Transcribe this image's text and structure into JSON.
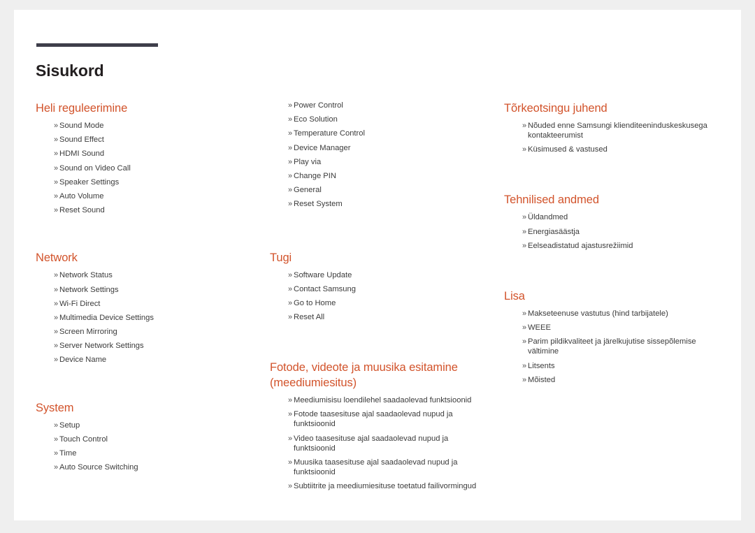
{
  "document": {
    "title": "Sisukord",
    "marker": "»",
    "accent_color": "#d2532b",
    "rule_color": "#3e3e4a",
    "title_color": "#231f20",
    "text_color": "#3b3b3b",
    "page_background": "#ffffff",
    "canvas_background": "#efefef"
  },
  "columns": [
    {
      "name": "column-1",
      "sections": [
        {
          "heading": "Heli reguleerimine",
          "entries": [
            "Sound Mode",
            "Sound Effect",
            "HDMI Sound",
            "Sound on Video Call",
            "Speaker Settings",
            "Auto Volume",
            "Reset Sound"
          ]
        },
        {
          "heading": "Network",
          "entries": [
            "Network Status",
            "Network Settings",
            "Wi-Fi Direct",
            "Multimedia Device Settings",
            "Screen Mirroring",
            "Server Network Settings",
            "Device Name"
          ]
        },
        {
          "heading": "System",
          "entries": [
            "Setup",
            "Touch Control",
            "Time",
            "Auto Source Switching"
          ]
        }
      ]
    },
    {
      "name": "column-2",
      "sections": [
        {
          "heading": "",
          "entries": [
            "Power Control",
            "Eco Solution",
            "Temperature Control",
            "Device Manager",
            "Play via",
            "Change PIN",
            "General",
            "Reset System"
          ]
        },
        {
          "heading": "Tugi",
          "entries": [
            "Software Update",
            "Contact Samsung",
            "Go to Home",
            "Reset All"
          ]
        },
        {
          "heading": "Fotode, videote ja muusika esitamine (meediumiesitus)",
          "entries": [
            "Meediumisisu loendilehel saadaolevad funktsioonid",
            "Fotode taasesituse ajal saadaolevad nupud ja funktsioonid",
            "Video taasesituse ajal saadaolevad nupud ja funktsioonid",
            "Muusika taasesituse ajal saadaolevad nupud ja funktsioonid",
            "Subtiitrite ja meediumiesituse toetatud failivormingud"
          ]
        }
      ]
    },
    {
      "name": "column-3",
      "sections": [
        {
          "heading": "Tõrkeotsingu juhend",
          "entries": [
            "Nõuded enne Samsungi klienditeeninduskeskusega kontakteerumist",
            "Küsimused & vastused"
          ]
        },
        {
          "heading": "Tehnilised andmed",
          "entries": [
            "Üldandmed",
            "Energiasäästja",
            "Eelseadistatud ajastusrežiimid"
          ]
        },
        {
          "heading": "Lisa",
          "entries": [
            "Makseteenuse vastutus (hind tarbijatele)",
            "WEEE",
            "Parim pildikvaliteet ja järelkujutise sissepõlemise vältimine",
            "Litsents",
            "Mõisted"
          ]
        }
      ]
    }
  ]
}
